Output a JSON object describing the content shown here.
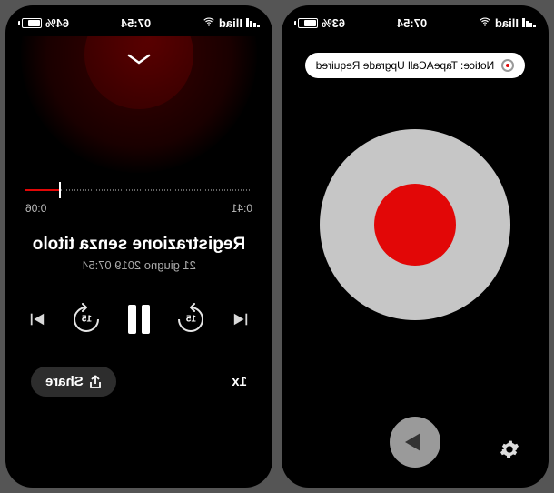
{
  "left": {
    "status": {
      "carrier": "Iliad",
      "time": "07:54",
      "battery_pct": "64%",
      "battery_fill_pct": 64
    },
    "timeline": {
      "elapsed": "0:06",
      "total": "0:41",
      "elapsed_fraction": 0.15
    },
    "title": "Registrazione senza titolo",
    "subtitle": "21 giugno 2019 07:54",
    "jump_seconds": "15",
    "speed_label": "1x",
    "share_label": "Share"
  },
  "right": {
    "status": {
      "carrier": "Iliad",
      "time": "07:54",
      "battery_pct": "63%",
      "battery_fill_pct": 63
    },
    "notice": "Notice: TapeACall Upgrade Required"
  }
}
